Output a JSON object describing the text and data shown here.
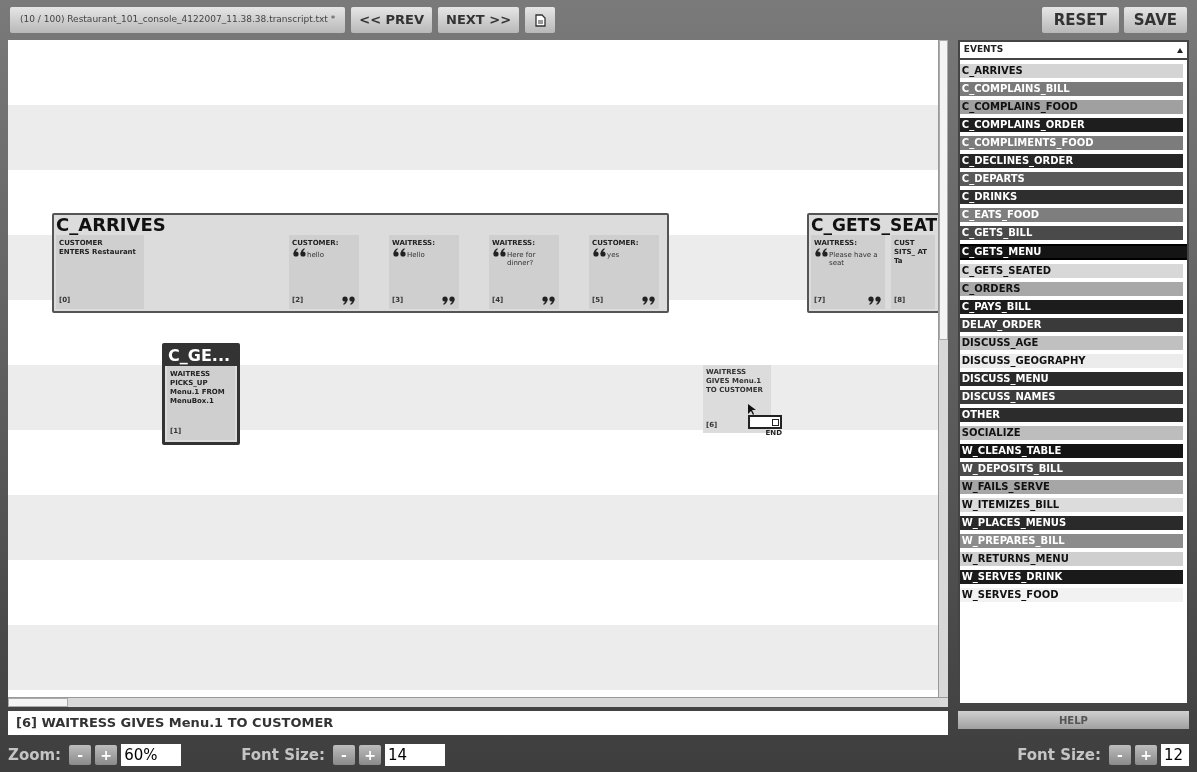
{
  "toolbar": {
    "file_button": "(10 / 100) Restaurant_101_console_4122007_11.38.38.transcript.txt *",
    "prev_button": "<< PREV",
    "next_button": "NEXT >>",
    "reset_button": "RESET",
    "save_button": "SAVE"
  },
  "canvas": {
    "event_cards": [
      {
        "kind": "wide",
        "title": "C_ARRIVES",
        "selected": false,
        "utterances": [
          {
            "kind": "action",
            "speaker": "CUSTOMER",
            "text": "ENTERS Restaurant",
            "index": "[0]"
          },
          {
            "kind": "speech",
            "speaker": "CUSTOMER:",
            "text": "hello",
            "index": "[2]"
          },
          {
            "kind": "speech",
            "speaker": "WAITRESS:",
            "text": "Hello",
            "index": "[3]"
          },
          {
            "kind": "speech",
            "speaker": "WAITRESS:",
            "text": "Here for dinner?",
            "index": "[4]"
          },
          {
            "kind": "speech",
            "speaker": "CUSTOMER:",
            "text": "yes",
            "index": "[5]"
          }
        ]
      },
      {
        "kind": "edge",
        "title": "C_GETS_SEAT",
        "selected": false,
        "utterances": [
          {
            "kind": "speech",
            "speaker": "WAITRESS:",
            "text": "Please have a seat",
            "index": "[7]"
          },
          {
            "kind": "action",
            "speaker": "CUST",
            "text": "SITS_ AT Ta",
            "index": "[8]"
          }
        ]
      },
      {
        "kind": "small",
        "title": "C_GE...",
        "selected": true,
        "utterances": [
          {
            "kind": "action",
            "speaker": "WAITRESS",
            "text": "PICKS_UP Menu.1 FROM MenuBox.1",
            "index": "[1]"
          }
        ]
      }
    ],
    "loose_utterance": {
      "speaker": "WAITRESS",
      "text": "GIVES Menu.1 TO CUSTOMER",
      "index": "[6]",
      "end_label": "END"
    }
  },
  "events_panel": {
    "header": "EVENTS",
    "items": [
      {
        "label": "C_ARRIVES",
        "color": "#d4d4d4",
        "selected": false
      },
      {
        "label": "C_COMPLAINS_BILL",
        "color": "#7a7a7a",
        "selected": false
      },
      {
        "label": "C_COMPLAINS_FOOD",
        "color": "#a0a0a0",
        "selected": false
      },
      {
        "label": "C_COMPLAINS_ORDER",
        "color": "#1e1e1e",
        "selected": false
      },
      {
        "label": "C_COMPLIMENTS_FOOD",
        "color": "#7c7c7c",
        "selected": false
      },
      {
        "label": "C_DECLINES_ORDER",
        "color": "#262626",
        "selected": false
      },
      {
        "label": "C_DEPARTS",
        "color": "#5a5a5a",
        "selected": false
      },
      {
        "label": "C_DRINKS",
        "color": "#2e2e2e",
        "selected": false
      },
      {
        "label": "C_EATS_FOOD",
        "color": "#7e7e7e",
        "selected": false
      },
      {
        "label": "C_GETS_BILL",
        "color": "#4a4a4a",
        "selected": false
      },
      {
        "label": "C_GETS_MENU",
        "color": "#141414",
        "selected": true
      },
      {
        "label": "C_GETS_SEATED",
        "color": "#d8d8d8",
        "selected": false
      },
      {
        "label": "C_ORDERS",
        "color": "#a8a8a8",
        "selected": false
      },
      {
        "label": "C_PAYS_BILL",
        "color": "#1c1c1c",
        "selected": false
      },
      {
        "label": "DELAY_ORDER",
        "color": "#3a3a3a",
        "selected": false
      },
      {
        "label": "DISCUSS_AGE",
        "color": "#c0c0c0",
        "selected": false
      },
      {
        "label": "DISCUSS_GEOGRAPHY",
        "color": "#ececec",
        "selected": false
      },
      {
        "label": "DISCUSS_MENU",
        "color": "#2a2a2a",
        "selected": false
      },
      {
        "label": "DISCUSS_NAMES",
        "color": "#3c3c3c",
        "selected": false
      },
      {
        "label": "OTHER",
        "color": "#2c2c2c",
        "selected": false
      },
      {
        "label": "SOCIALIZE",
        "color": "#bdbdbd",
        "selected": false
      },
      {
        "label": "W_CLEANS_TABLE",
        "color": "#141414",
        "selected": false
      },
      {
        "label": "W_DEPOSITS_BILL",
        "color": "#4c4c4c",
        "selected": false
      },
      {
        "label": "W_FAILS_SERVE",
        "color": "#a6a6a6",
        "selected": false
      },
      {
        "label": "W_ITEMIZES_BILL",
        "color": "#dcdcdc",
        "selected": false
      },
      {
        "label": "W_PLACES_MENUS",
        "color": "#2a2a2a",
        "selected": false
      },
      {
        "label": "W_PREPARES_BILL",
        "color": "#8c8c8c",
        "selected": false
      },
      {
        "label": "W_RETURNS_MENU",
        "color": "#cfcfcf",
        "selected": false
      },
      {
        "label": "W_SERVES_DRINK",
        "color": "#1a1a1a",
        "selected": false
      },
      {
        "label": "W_SERVES_FOOD",
        "color": "#f2f2f2",
        "selected": false
      }
    ],
    "help_button": "HELP"
  },
  "status_bar": {
    "text": "[6] WAITRESS GIVES Menu.1 TO CUSTOMER"
  },
  "bottom_bar": {
    "zoom": {
      "label": "Zoom:",
      "minus": "-",
      "plus": "+",
      "value": "60%"
    },
    "font_size": {
      "label": "Font Size:",
      "minus": "-",
      "plus": "+",
      "value": "14"
    },
    "panel_font_size": {
      "label": "Font Size:",
      "minus": "-",
      "plus": "+",
      "value": "12"
    }
  }
}
